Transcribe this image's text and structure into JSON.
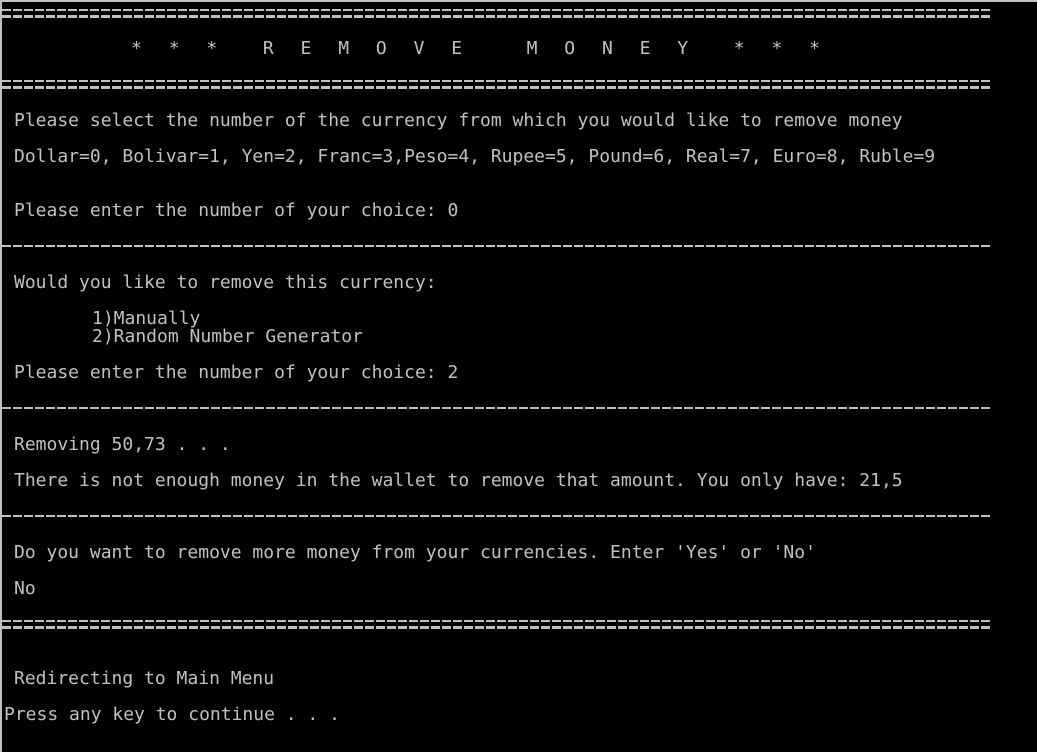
{
  "title": "* * *  R E M O V E   M O N E Y  * * *",
  "currency_prompt": "Please select the number of the currency from which you would like to remove money",
  "currency_list": "Dollar=0, Bolivar=1, Yen=2, Franc=3,Peso=4, Rupee=5, Pound=6, Real=7, Euro=8, Ruble=9",
  "choice_prompt_1": "Please enter the number of your choice: 0",
  "method_prompt": "Would you like to remove this currency:",
  "method_options": [
    "1)Manually",
    "2)Random Number Generator"
  ],
  "choice_prompt_2": "Please enter the number of your choice: 2",
  "removing_text": "Removing 50,73 . . .",
  "error_text": "There is not enough money in the wallet to remove that amount. You only have: 21,5",
  "more_prompt": "Do you want to remove more money from your currencies. Enter 'Yes' or 'No'",
  "more_answer": "No",
  "redirect_text": "Redirecting to Main Menu",
  "continue_text": "Press any key to continue . . .",
  "colors": {
    "background": "#000000",
    "text": "#c0c0c0"
  }
}
